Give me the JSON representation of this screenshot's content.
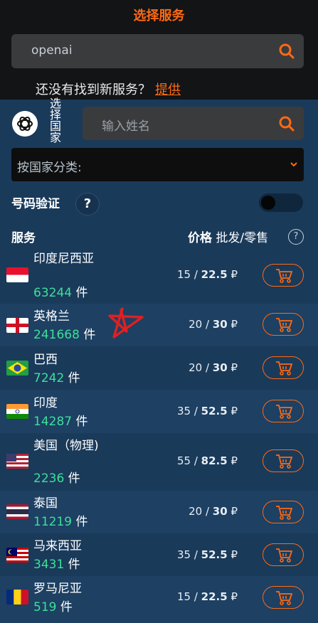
{
  "header": {
    "title": "选择服务"
  },
  "service_search": {
    "value": "openai"
  },
  "not_found": {
    "text": "还没有找到新服务？",
    "link": "提供"
  },
  "country_search": {
    "vertical_label": "选择国家",
    "placeholder": "输入姓名"
  },
  "sort_select": {
    "label": "按国家分类:"
  },
  "verify": {
    "label": "号码验证",
    "help": "?"
  },
  "table_header": {
    "service": "服务",
    "price": "价格",
    "price_mode": "批发/零售",
    "help": "?"
  },
  "unit": "件",
  "currency": "₽",
  "rows": [
    {
      "country": "印度尼西亚",
      "flag": "indonesia",
      "count": "63244",
      "wholesale": "15",
      "retail": "22.5"
    },
    {
      "country": "英格兰",
      "flag": "england",
      "count": "241668",
      "wholesale": "20",
      "retail": "30"
    },
    {
      "country": "巴西",
      "flag": "brazil",
      "count": "7242",
      "wholesale": "20",
      "retail": "30"
    },
    {
      "country": "印度",
      "flag": "india",
      "count": "14287",
      "wholesale": "35",
      "retail": "52.5"
    },
    {
      "country": "美国（物理)",
      "flag": "usa",
      "count": "2236",
      "wholesale": "55",
      "retail": "82.5"
    },
    {
      "country": "泰国",
      "flag": "thailand",
      "count": "11219",
      "wholesale": "20",
      "retail": "30"
    },
    {
      "country": "马来西亚",
      "flag": "malaysia",
      "count": "3431",
      "wholesale": "35",
      "retail": "52.5"
    },
    {
      "country": "罗马尼亚",
      "flag": "romania",
      "count": "519",
      "wholesale": "15",
      "retail": "22.5"
    }
  ],
  "colors": {
    "accent": "#ff6a13",
    "count_green": "#3be09a",
    "panel": "#1a3a5a"
  }
}
